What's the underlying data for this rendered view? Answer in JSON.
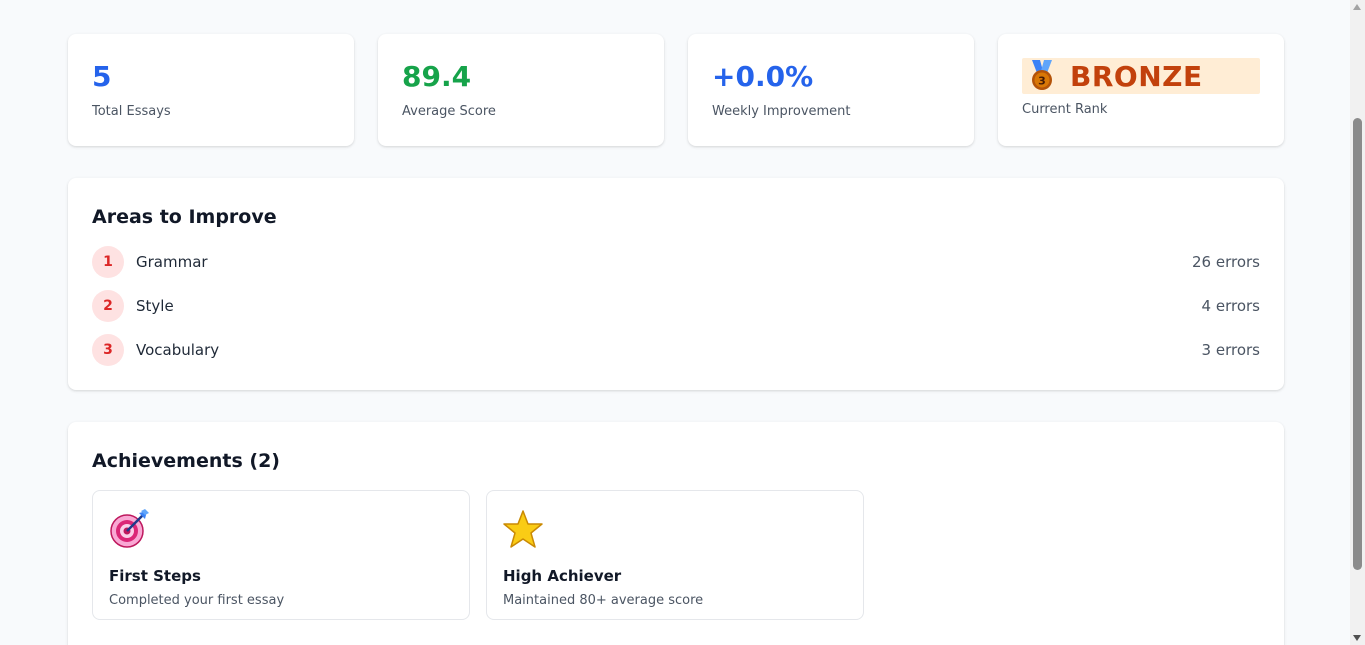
{
  "stats": [
    {
      "value": "5",
      "label": "Total Essays",
      "color": "#2563eb"
    },
    {
      "value": "89.4",
      "label": "Average Score",
      "color": "#16a34a"
    },
    {
      "value": "+0.0%",
      "label": "Weekly Improvement",
      "color": "#2563eb"
    }
  ],
  "rank": {
    "value": "BRONZE",
    "label": "Current Rank",
    "icon": "bronze-medal-icon",
    "color": "#c2410c"
  },
  "improve": {
    "title": "Areas to Improve",
    "items": [
      {
        "rank": "1",
        "name": "Grammar",
        "count": "26 errors"
      },
      {
        "rank": "2",
        "name": "Style",
        "count": "4 errors"
      },
      {
        "rank": "3",
        "name": "Vocabulary",
        "count": "3 errors"
      }
    ]
  },
  "achievements": {
    "title": "Achievements (2)",
    "items": [
      {
        "icon": "target-icon",
        "name": "First Steps",
        "desc": "Completed your first essay"
      },
      {
        "icon": "star-icon",
        "name": "High Achiever",
        "desc": "Maintained 80+ average score"
      }
    ]
  }
}
